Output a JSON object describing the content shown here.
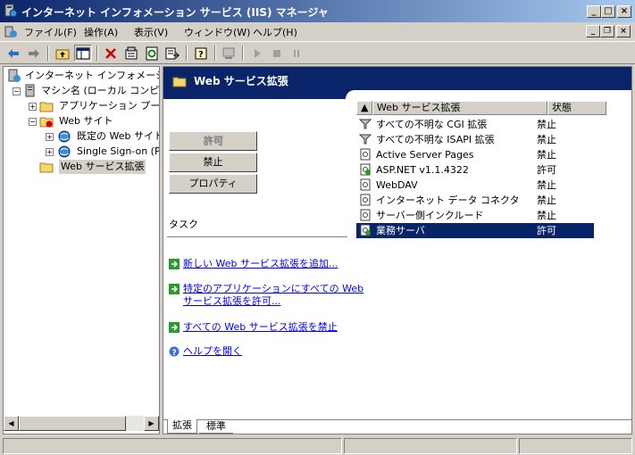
{
  "window": {
    "title": "インターネット インフォメーション サービス (IIS) マネージャ"
  },
  "menu": {
    "items": [
      "ファイル(F)",
      "操作(A)",
      "表示(V)",
      "ウィンドウ(W)",
      "ヘルプ(H)"
    ]
  },
  "tree": {
    "root": "インターネット インフォメーション",
    "machine": "マシン名 (ローカル コンピ",
    "app_pools": "アプリケーション プール",
    "websites": "Web サイト",
    "default_site": "既定の Web サイト",
    "sso": "Single Sign-on (P",
    "extensions": "Web サービス拡張"
  },
  "header": {
    "title": "Web サービス拡張"
  },
  "buttons": {
    "allow": "許可",
    "prohibit": "禁止",
    "properties": "プロパティ"
  },
  "tasks": {
    "label": "タスク",
    "add": "新しい Web サービス拡張を追加...",
    "allow_all_1": "特定のアプリケーションにすべての Web",
    "allow_all_2": "サービス拡張を許可...",
    "prohibit_all": "すべての Web サービス拡張を禁止",
    "help": "ヘルプを開く"
  },
  "list": {
    "col_name": "Web サービス拡張",
    "col_state": "状態",
    "rows": [
      {
        "name": "すべての不明な CGI 拡張",
        "state": "禁止",
        "icon": "filter-icon"
      },
      {
        "name": "すべての不明な ISAPI 拡張",
        "state": "禁止",
        "icon": "filter-icon"
      },
      {
        "name": "Active Server Pages",
        "state": "禁止",
        "icon": "extension-icon"
      },
      {
        "name": "ASP.NET v1.1.4322",
        "state": "許可",
        "icon": "extension-allowed-icon"
      },
      {
        "name": "WebDAV",
        "state": "禁止",
        "icon": "extension-icon"
      },
      {
        "name": "インターネット データ コネクタ",
        "state": "禁止",
        "icon": "extension-icon"
      },
      {
        "name": "サーバー側インクルード",
        "state": "禁止",
        "icon": "extension-icon"
      },
      {
        "name": "業務サーバ",
        "state": "許可",
        "icon": "extension-allowed-icon",
        "selected": true
      }
    ]
  },
  "tabs": {
    "extended": "拡張",
    "standard": "標準"
  },
  "colors": {
    "title_start": "#0a246a",
    "title_end": "#a6caf0",
    "selection": "#0a246a",
    "link": "#0000ff",
    "face": "#d4d0c8"
  }
}
